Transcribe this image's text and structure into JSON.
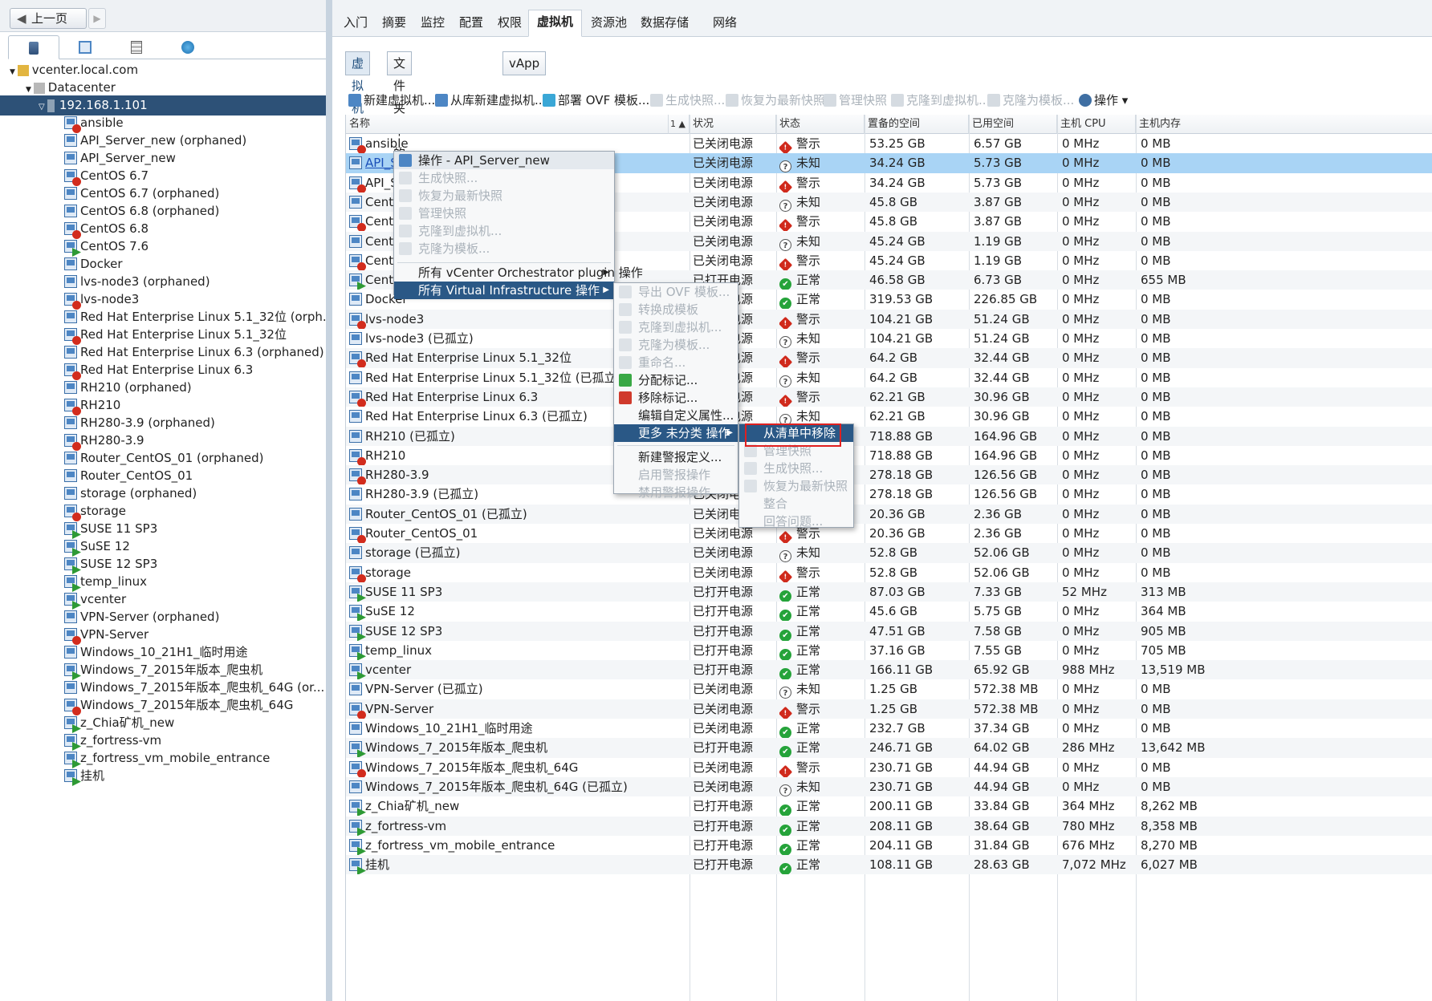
{
  "nav": {
    "back_label": "上一页",
    "back_arrow": "◀",
    "forward_arrow": "▶"
  },
  "tree": {
    "root": "vcenter.local.com",
    "datacenter": "Datacenter",
    "host": "192.168.1.101",
    "vms": [
      {
        "name": "ansible",
        "power": "off"
      },
      {
        "name": "API_Server_new (orphaned)",
        "power": "none"
      },
      {
        "name": "API_Server_new",
        "power": "none"
      },
      {
        "name": "CentOS 6.7",
        "power": "off"
      },
      {
        "name": "CentOS 6.7 (orphaned)",
        "power": "none"
      },
      {
        "name": "CentOS 6.8 (orphaned)",
        "power": "none"
      },
      {
        "name": "CentOS 6.8",
        "power": "off"
      },
      {
        "name": "CentOS 7.6",
        "power": "on"
      },
      {
        "name": "Docker",
        "power": "none"
      },
      {
        "name": "lvs-node3 (orphaned)",
        "power": "none"
      },
      {
        "name": "lvs-node3",
        "power": "off"
      },
      {
        "name": "Red Hat Enterprise Linux 5.1_32位 (orph...",
        "power": "none"
      },
      {
        "name": "Red Hat Enterprise Linux 5.1_32位",
        "power": "off"
      },
      {
        "name": "Red Hat Enterprise Linux 6.3 (orphaned)",
        "power": "none"
      },
      {
        "name": "Red Hat Enterprise Linux 6.3",
        "power": "off"
      },
      {
        "name": "RH210 (orphaned)",
        "power": "none"
      },
      {
        "name": "RH210",
        "power": "off"
      },
      {
        "name": "RH280-3.9 (orphaned)",
        "power": "none"
      },
      {
        "name": "RH280-3.9",
        "power": "off"
      },
      {
        "name": "Router_CentOS_01 (orphaned)",
        "power": "none"
      },
      {
        "name": "Router_CentOS_01",
        "power": "none"
      },
      {
        "name": "storage (orphaned)",
        "power": "none"
      },
      {
        "name": "storage",
        "power": "off"
      },
      {
        "name": "SUSE 11 SP3",
        "power": "on"
      },
      {
        "name": "SuSE 12",
        "power": "on"
      },
      {
        "name": "SUSE 12 SP3",
        "power": "on"
      },
      {
        "name": "temp_linux",
        "power": "on"
      },
      {
        "name": "vcenter",
        "power": "on"
      },
      {
        "name": "VPN-Server (orphaned)",
        "power": "none"
      },
      {
        "name": "VPN-Server",
        "power": "off"
      },
      {
        "name": "Windows_10_21H1_临时用途",
        "power": "none"
      },
      {
        "name": "Windows_7_2015年版本_爬虫机",
        "power": "on"
      },
      {
        "name": "Windows_7_2015年版本_爬虫机_64G (or...",
        "power": "none"
      },
      {
        "name": "Windows_7_2015年版本_爬虫机_64G",
        "power": "off"
      },
      {
        "name": "z_Chia矿机_new",
        "power": "on"
      },
      {
        "name": "z_fortress-vm",
        "power": "on"
      },
      {
        "name": "z_fortress_vm_mobile_entrance",
        "power": "on"
      },
      {
        "name": "挂机",
        "power": "on"
      }
    ]
  },
  "top_tabs": [
    "入门",
    "摘要",
    "监控",
    "配置",
    "权限",
    "虚拟机",
    "资源池",
    "数据存储",
    "网络"
  ],
  "sub_tabs": [
    "虚拟机",
    "文件夹中的虚拟机模板",
    "vApp"
  ],
  "toolbar": {
    "new_vm": "新建虚拟机...",
    "new_from_lib": "从库新建虚拟机...",
    "deploy_ovf": "部署 OVF 模板...",
    "snapshot": "生成快照...",
    "revert": "恢复为最新快照",
    "manage": "管理快照",
    "clone_vm": "克隆到虚拟机...",
    "clone_tpl": "克隆为模板...",
    "actions": "操作 ▾"
  },
  "columns": [
    "名称",
    "1 ▲",
    "状况",
    "状态",
    "置备的空间",
    "已用空间",
    "主机 CPU",
    "主机内存"
  ],
  "rows": [
    [
      "ansible",
      "已关闭电源",
      "warn",
      "警示",
      "53.25  GB",
      "6.57  GB",
      "0 MHz",
      "0 MB"
    ],
    [
      "API_Server_new (已孤立)",
      "已关闭电源",
      "unk",
      "未知",
      "34.24  GB",
      "5.73  GB",
      "0 MHz",
      "0 MB"
    ],
    [
      "API_Server_new",
      "已关闭电源",
      "warn",
      "警示",
      "34.24  GB",
      "5.73  GB",
      "0 MHz",
      "0 MB"
    ],
    [
      "CentOS 6.7 (已孤立)",
      "已关闭电源",
      "unk",
      "未知",
      "45.8  GB",
      "3.87  GB",
      "0 MHz",
      "0 MB"
    ],
    [
      "CentOS 6.7",
      "已关闭电源",
      "warn",
      "警示",
      "45.8  GB",
      "3.87  GB",
      "0 MHz",
      "0 MB"
    ],
    [
      "CentOS 6.8 (已孤立)",
      "已关闭电源",
      "unk",
      "未知",
      "45.24  GB",
      "1.19  GB",
      "0 MHz",
      "0 MB"
    ],
    [
      "CentOS 6.8",
      "已关闭电源",
      "warn",
      "警示",
      "45.24  GB",
      "1.19  GB",
      "0 MHz",
      "0 MB"
    ],
    [
      "CentOS 7.6",
      "已打开电源",
      "ok",
      "正常",
      "46.58  GB",
      "6.73  GB",
      "0 MHz",
      "655 MB"
    ],
    [
      "Docker",
      "已关闭电源",
      "ok",
      "正常",
      "319.53  GB",
      "226.85  GB",
      "0 MHz",
      "0 MB"
    ],
    [
      "lvs-node3",
      "已关闭电源",
      "warn",
      "警示",
      "104.21  GB",
      "51.24  GB",
      "0 MHz",
      "0 MB"
    ],
    [
      "lvs-node3 (已孤立)",
      "已关闭电源",
      "unk",
      "未知",
      "104.21  GB",
      "51.24  GB",
      "0 MHz",
      "0 MB"
    ],
    [
      "Red Hat Enterprise Linux 5.1_32位",
      "已关闭电源",
      "warn",
      "警示",
      "64.2  GB",
      "32.44  GB",
      "0 MHz",
      "0 MB"
    ],
    [
      "Red Hat Enterprise Linux 5.1_32位 (已孤立)",
      "已关闭电源",
      "unk",
      "未知",
      "64.2  GB",
      "32.44  GB",
      "0 MHz",
      "0 MB"
    ],
    [
      "Red Hat Enterprise Linux 6.3",
      "已关闭电源",
      "warn",
      "警示",
      "62.21  GB",
      "30.96  GB",
      "0 MHz",
      "0 MB"
    ],
    [
      "Red Hat Enterprise Linux 6.3 (已孤立)",
      "已关闭电源",
      "unk",
      "未知",
      "62.21  GB",
      "30.96  GB",
      "0 MHz",
      "0 MB"
    ],
    [
      "RH210 (已孤立)",
      "已关闭电源",
      "unk",
      "未知",
      "718.88  GB",
      "164.96  GB",
      "0 MHz",
      "0 MB"
    ],
    [
      "RH210",
      "已关闭电源",
      "warn",
      "警示",
      "718.88  GB",
      "164.96  GB",
      "0 MHz",
      "0 MB"
    ],
    [
      "RH280-3.9",
      "已关闭电源",
      "warn",
      "警示",
      "278.18  GB",
      "126.56  GB",
      "0 MHz",
      "0 MB"
    ],
    [
      "RH280-3.9 (已孤立)",
      "已关闭电源",
      "unk",
      "未知",
      "278.18  GB",
      "126.56  GB",
      "0 MHz",
      "0 MB"
    ],
    [
      "Router_CentOS_01 (已孤立)",
      "已关闭电源",
      "unk",
      "未知",
      "20.36  GB",
      "2.36  GB",
      "0 MHz",
      "0 MB"
    ],
    [
      "Router_CentOS_01",
      "已关闭电源",
      "warn",
      "警示",
      "20.36  GB",
      "2.36  GB",
      "0 MHz",
      "0 MB"
    ],
    [
      "storage (已孤立)",
      "已关闭电源",
      "unk",
      "未知",
      "52.8  GB",
      "52.06  GB",
      "0 MHz",
      "0 MB"
    ],
    [
      "storage",
      "已关闭电源",
      "warn",
      "警示",
      "52.8  GB",
      "52.06  GB",
      "0 MHz",
      "0 MB"
    ],
    [
      "SUSE 11 SP3",
      "已打开电源",
      "ok",
      "正常",
      "87.03  GB",
      "7.33  GB",
      "52 MHz",
      "313 MB"
    ],
    [
      "SuSE 12",
      "已打开电源",
      "ok",
      "正常",
      "45.6  GB",
      "5.75  GB",
      "0 MHz",
      "364 MB"
    ],
    [
      "SUSE 12 SP3",
      "已打开电源",
      "ok",
      "正常",
      "47.51  GB",
      "7.58  GB",
      "0 MHz",
      "905 MB"
    ],
    [
      "temp_linux",
      "已打开电源",
      "ok",
      "正常",
      "37.16  GB",
      "7.55  GB",
      "0 MHz",
      "705 MB"
    ],
    [
      "vcenter",
      "已打开电源",
      "ok",
      "正常",
      "166.11  GB",
      "65.92  GB",
      "988 MHz",
      "13,519 MB"
    ],
    [
      "VPN-Server (已孤立)",
      "已关闭电源",
      "unk",
      "未知",
      "1.25  GB",
      "572.38  MB",
      "0 MHz",
      "0 MB"
    ],
    [
      "VPN-Server",
      "已关闭电源",
      "warn",
      "警示",
      "1.25  GB",
      "572.38  MB",
      "0 MHz",
      "0 MB"
    ],
    [
      "Windows_10_21H1_临时用途",
      "已关闭电源",
      "ok",
      "正常",
      "232.7  GB",
      "37.34  GB",
      "0 MHz",
      "0 MB"
    ],
    [
      "Windows_7_2015年版本_爬虫机",
      "已打开电源",
      "ok",
      "正常",
      "246.71  GB",
      "64.02  GB",
      "286 MHz",
      "13,642 MB"
    ],
    [
      "Windows_7_2015年版本_爬虫机_64G",
      "已关闭电源",
      "warn",
      "警示",
      "230.71  GB",
      "44.94  GB",
      "0 MHz",
      "0 MB"
    ],
    [
      "Windows_7_2015年版本_爬虫机_64G (已孤立)",
      "已关闭电源",
      "unk",
      "未知",
      "230.71  GB",
      "44.94  GB",
      "0 MHz",
      "0 MB"
    ],
    [
      "z_Chia矿机_new",
      "已打开电源",
      "ok",
      "正常",
      "200.11  GB",
      "33.84  GB",
      "364 MHz",
      "8,262 MB"
    ],
    [
      "z_fortress-vm",
      "已打开电源",
      "ok",
      "正常",
      "208.11  GB",
      "38.64  GB",
      "780 MHz",
      "8,358 MB"
    ],
    [
      "z_fortress_vm_mobile_entrance",
      "已打开电源",
      "ok",
      "正常",
      "204.11  GB",
      "31.84  GB",
      "676 MHz",
      "8,270 MB"
    ],
    [
      "挂机",
      "已打开电源",
      "ok",
      "正常",
      "108.11  GB",
      "28.63  GB",
      "7,072 MHz",
      "6,027 MB"
    ]
  ],
  "menu1": {
    "header": "操作 - API_Server_new",
    "items": [
      "生成快照...",
      "恢复为最新快照",
      "管理快照",
      "克隆到虚拟机...",
      "克隆为模板..."
    ],
    "orchestrator": "所有 vCenter Orchestrator plugin 操作",
    "vi": "所有 Virtual Infrastructure 操作"
  },
  "menu2": {
    "items": [
      "导出 OVF 模板...",
      "转换成模板",
      "克隆到虚拟机...",
      "克隆为模板...",
      "重命名...",
      "分配标记...",
      "移除标记...",
      "编辑自定义属性...",
      "更多 未分类 操作",
      "新建警报定义...",
      "启用警报操作",
      "禁用警报操作"
    ]
  },
  "menu3": {
    "items": [
      "从清单中移除",
      "管理快照",
      "生成快照...",
      "恢复为最新快照",
      "整合",
      "回答问题..."
    ]
  },
  "status_icons": {
    "warn": "!",
    "ok": "✔",
    "unk": "?"
  },
  "colors": {
    "selected_tree": "#2d5177",
    "selected_row": "#a9d4f5",
    "menu_highlight": "#2a5886",
    "highlight_box": "#e02020"
  }
}
